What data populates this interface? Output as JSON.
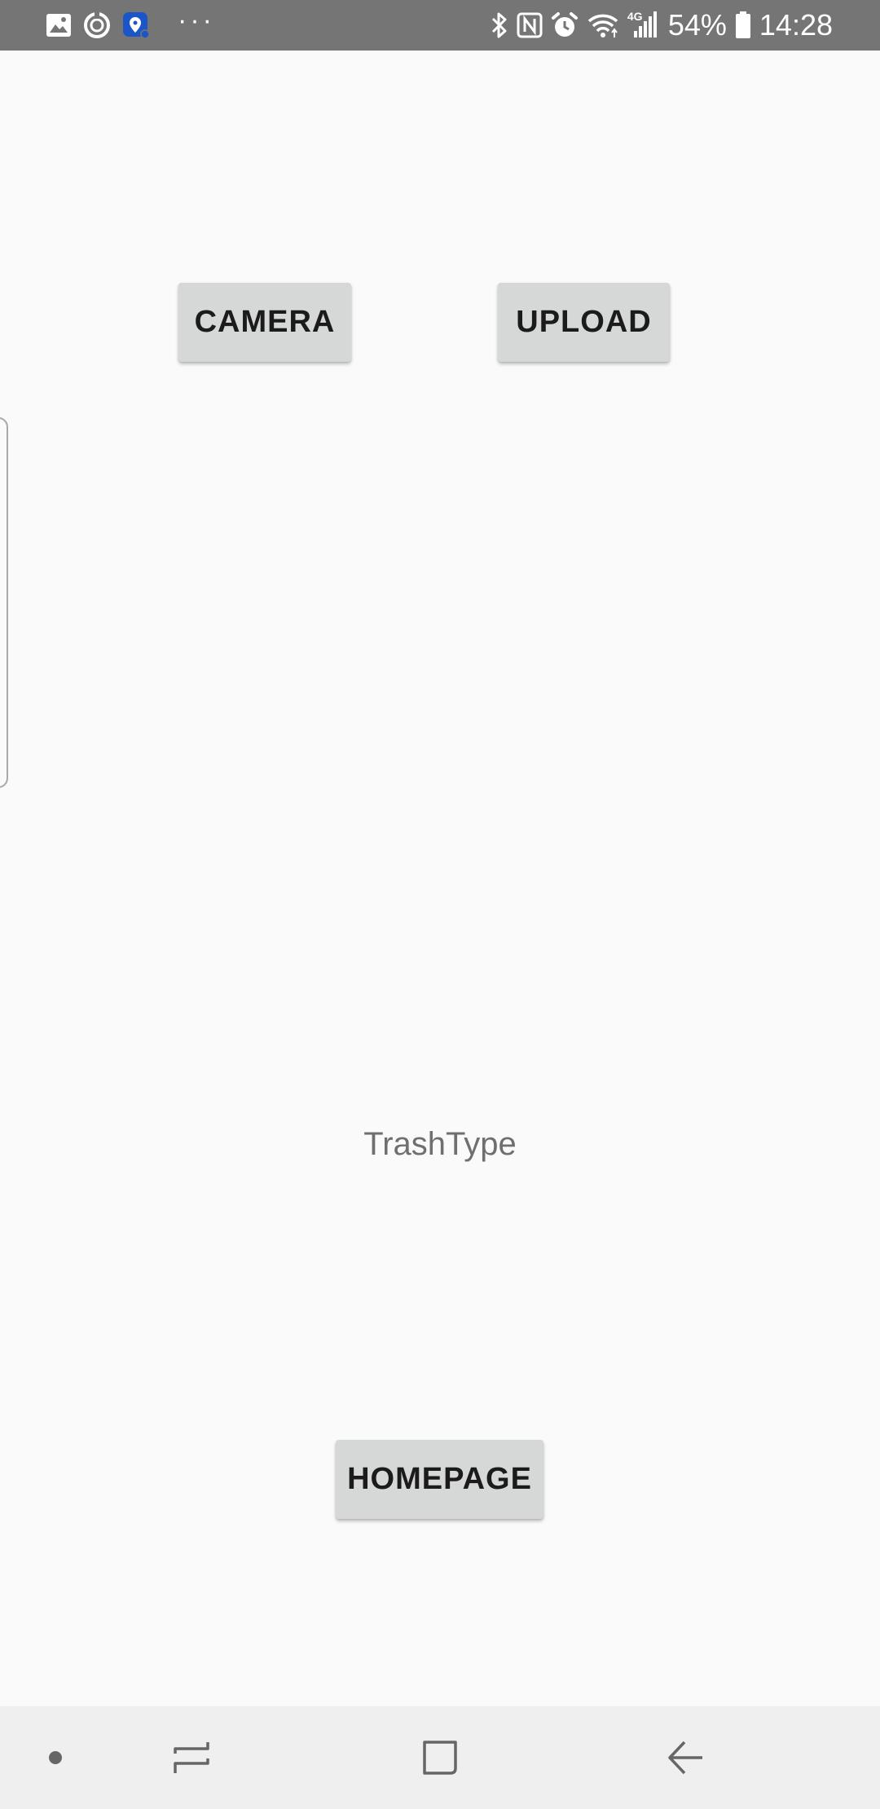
{
  "status_bar": {
    "left_icons": [
      "gallery-icon",
      "sync-icon",
      "location-app-icon"
    ],
    "overflow_dots": "···",
    "right_icons": [
      "bluetooth-icon",
      "nfc-icon",
      "alarm-icon",
      "wifi-icon",
      "signal-icon"
    ],
    "network_label": "4G",
    "battery_percent": "54%",
    "time": "14:28",
    "background_color": "#757575"
  },
  "main": {
    "camera_button_label": "CAMERA",
    "upload_button_label": "UPLOAD",
    "result_text": "TrashType",
    "homepage_button_label": "HOMEPAGE"
  },
  "nav_bar": {
    "items": [
      "dot-indicator-icon",
      "recents-icon",
      "home-icon",
      "back-icon"
    ],
    "background_color": "#efefef"
  },
  "colors": {
    "page_background": "#fafafa",
    "button_background": "#d6d7d7",
    "button_text": "#1b1b1b",
    "result_text": "#6f6f6f"
  }
}
